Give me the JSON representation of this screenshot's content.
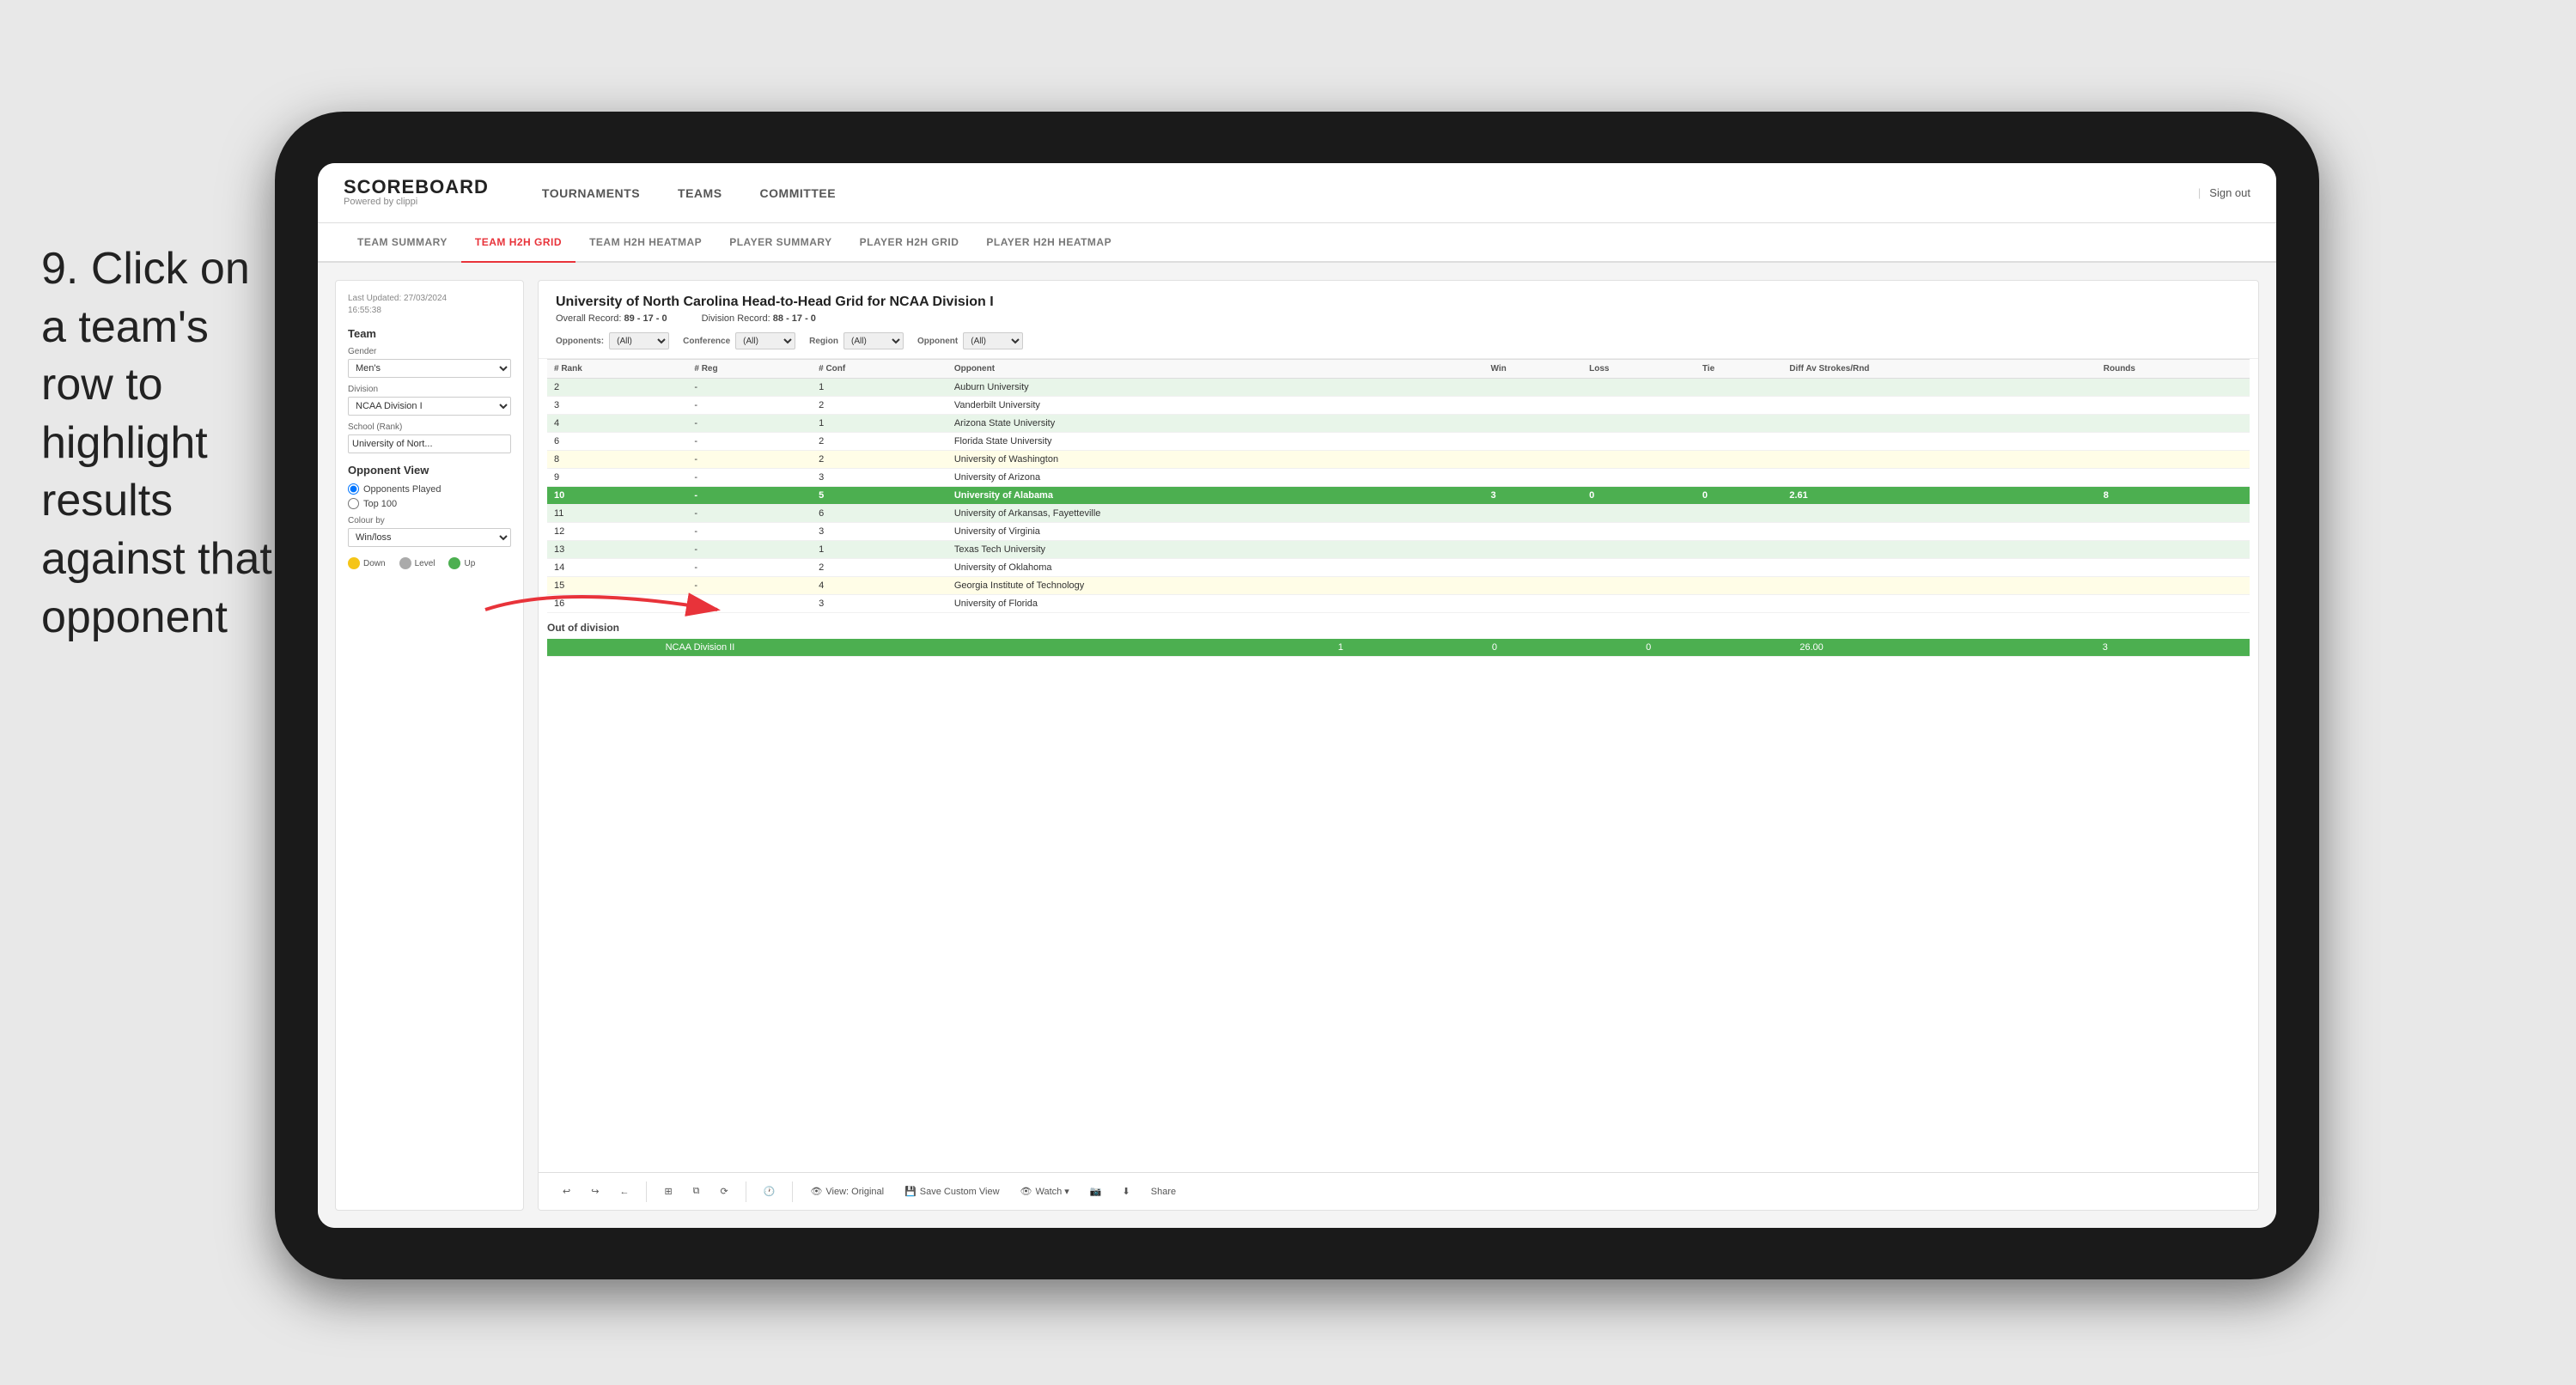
{
  "instruction": {
    "step": "9.",
    "text": "Click on a team's row to highlight results against that opponent"
  },
  "nav": {
    "logo_title": "SCOREBOARD",
    "logo_subtitle": "Powered by clippi",
    "items": [
      "TOURNAMENTS",
      "TEAMS",
      "COMMITTEE"
    ],
    "sign_in_divider": "|",
    "sign_out": "Sign out"
  },
  "sub_nav": {
    "items": [
      "TEAM SUMMARY",
      "TEAM H2H GRID",
      "TEAM H2H HEATMAP",
      "PLAYER SUMMARY",
      "PLAYER H2H GRID",
      "PLAYER H2H HEATMAP"
    ],
    "active": "TEAM H2H GRID"
  },
  "left_panel": {
    "last_updated_label": "Last Updated: 27/03/2024",
    "last_updated_time": "16:55:38",
    "team_section": "Team",
    "gender_label": "Gender",
    "gender_value": "Men's",
    "division_label": "Division",
    "division_value": "NCAA Division I",
    "school_label": "School (Rank)",
    "school_value": "University of Nort...",
    "opponent_view_label": "Opponent View",
    "opponents_played": "Opponents Played",
    "top_100": "Top 100",
    "colour_by_label": "Colour by",
    "colour_by_value": "Win/loss",
    "legend": {
      "down": "Down",
      "level": "Level",
      "up": "Up"
    }
  },
  "main_table": {
    "title": "University of North Carolina Head-to-Head Grid for NCAA Division I",
    "overall_record_label": "Overall Record:",
    "overall_record": "89 - 17 - 0",
    "division_record_label": "Division Record:",
    "division_record": "88 - 17 - 0",
    "filters": {
      "opponents_label": "Opponents:",
      "opponents_value": "(All)",
      "conference_label": "Conference",
      "conference_value": "(All)",
      "region_label": "Region",
      "region_value": "(All)",
      "opponent_label": "Opponent",
      "opponent_value": "(All)"
    },
    "columns": [
      "# Rank",
      "# Reg",
      "# Conf",
      "Opponent",
      "Win",
      "Loss",
      "Tie",
      "Diff Av Strokes/Rnd",
      "Rounds"
    ],
    "rows": [
      {
        "rank": "2",
        "reg": "-",
        "conf": "1",
        "opponent": "Auburn University",
        "win": "",
        "loss": "",
        "tie": "",
        "diff": "",
        "rounds": "",
        "style": "light-green"
      },
      {
        "rank": "3",
        "reg": "-",
        "conf": "2",
        "opponent": "Vanderbilt University",
        "win": "",
        "loss": "",
        "tie": "",
        "diff": "",
        "rounds": "",
        "style": "normal"
      },
      {
        "rank": "4",
        "reg": "-",
        "conf": "1",
        "opponent": "Arizona State University",
        "win": "",
        "loss": "",
        "tie": "",
        "diff": "",
        "rounds": "",
        "style": "light-green"
      },
      {
        "rank": "6",
        "reg": "-",
        "conf": "2",
        "opponent": "Florida State University",
        "win": "",
        "loss": "",
        "tie": "",
        "diff": "",
        "rounds": "",
        "style": "normal"
      },
      {
        "rank": "8",
        "reg": "-",
        "conf": "2",
        "opponent": "University of Washington",
        "win": "",
        "loss": "",
        "tie": "",
        "diff": "",
        "rounds": "",
        "style": "light-yellow"
      },
      {
        "rank": "9",
        "reg": "-",
        "conf": "3",
        "opponent": "University of Arizona",
        "win": "",
        "loss": "",
        "tie": "",
        "diff": "",
        "rounds": "",
        "style": "normal"
      },
      {
        "rank": "10",
        "reg": "-",
        "conf": "5",
        "opponent": "University of Alabama",
        "win": "3",
        "loss": "0",
        "tie": "0",
        "diff": "2.61",
        "rounds": "8",
        "style": "highlighted"
      },
      {
        "rank": "11",
        "reg": "-",
        "conf": "6",
        "opponent": "University of Arkansas, Fayetteville",
        "win": "",
        "loss": "",
        "tie": "",
        "diff": "",
        "rounds": "",
        "style": "light-green"
      },
      {
        "rank": "12",
        "reg": "-",
        "conf": "3",
        "opponent": "University of Virginia",
        "win": "",
        "loss": "",
        "tie": "",
        "diff": "",
        "rounds": "",
        "style": "normal"
      },
      {
        "rank": "13",
        "reg": "-",
        "conf": "1",
        "opponent": "Texas Tech University",
        "win": "",
        "loss": "",
        "tie": "",
        "diff": "",
        "rounds": "",
        "style": "light-green"
      },
      {
        "rank": "14",
        "reg": "-",
        "conf": "2",
        "opponent": "University of Oklahoma",
        "win": "",
        "loss": "",
        "tie": "",
        "diff": "",
        "rounds": "",
        "style": "normal"
      },
      {
        "rank": "15",
        "reg": "-",
        "conf": "4",
        "opponent": "Georgia Institute of Technology",
        "win": "",
        "loss": "",
        "tie": "",
        "diff": "",
        "rounds": "",
        "style": "light-yellow"
      },
      {
        "rank": "16",
        "reg": "-",
        "conf": "3",
        "opponent": "University of Florida",
        "win": "",
        "loss": "",
        "tie": "",
        "diff": "",
        "rounds": "",
        "style": "normal"
      }
    ],
    "out_of_division_label": "Out of division",
    "out_of_division_row": {
      "label": "NCAA Division II",
      "win": "1",
      "loss": "0",
      "tie": "0",
      "diff": "26.00",
      "rounds": "3",
      "style": "highlighted"
    }
  },
  "toolbar": {
    "undo": "↩",
    "redo": "↪",
    "back": "←",
    "view_original": "View: Original",
    "save_custom": "Save Custom View",
    "watch": "Watch ▾",
    "share": "Share",
    "icons": {
      "camera": "📷",
      "grid": "⊞",
      "clock": "🕐"
    }
  }
}
